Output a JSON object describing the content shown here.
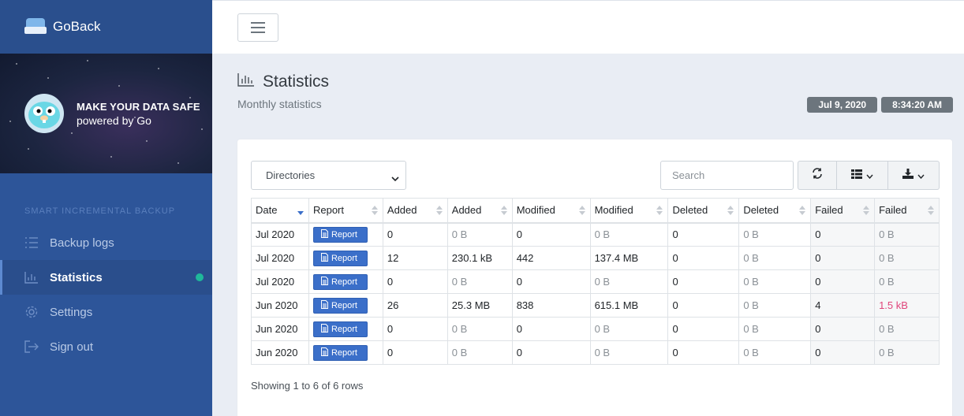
{
  "app": {
    "name": "GoBack"
  },
  "hero": {
    "title": "MAKE YOUR DATA SAFE",
    "subtitle": "powered by Go"
  },
  "sidebar": {
    "section_label": "SMART INCREMENTAL BACKUP",
    "items": [
      {
        "label": "Backup logs",
        "icon": "list-icon",
        "active": false
      },
      {
        "label": "Statistics",
        "icon": "bar-chart-icon",
        "active": true
      },
      {
        "label": "Settings",
        "icon": "gear-icon",
        "active": false
      },
      {
        "label": "Sign out",
        "icon": "sign-out-icon",
        "active": false
      }
    ]
  },
  "page": {
    "title": "Statistics",
    "subtitle": "Monthly statistics",
    "date": "Jul 9, 2020",
    "time": "8:34:20 AM"
  },
  "toolbar": {
    "select_value": "Directories",
    "search_placeholder": "Search"
  },
  "table": {
    "columns": [
      "Date",
      "Report",
      "Added",
      "Added",
      "Modified",
      "Modified",
      "Deleted",
      "Deleted",
      "Failed",
      "Failed"
    ],
    "report_label": "Report",
    "rows": [
      {
        "date": "Jul 2020",
        "added": "0",
        "added_size": "0 B",
        "modified": "0",
        "modified_size": "0 B",
        "deleted": "0",
        "deleted_size": "0 B",
        "failed": "0",
        "failed_size": "0 B"
      },
      {
        "date": "Jul 2020",
        "added": "12",
        "added_size": "230.1 kB",
        "modified": "442",
        "modified_size": "137.4 MB",
        "deleted": "0",
        "deleted_size": "0 B",
        "failed": "0",
        "failed_size": "0 B"
      },
      {
        "date": "Jul 2020",
        "added": "0",
        "added_size": "0 B",
        "modified": "0",
        "modified_size": "0 B",
        "deleted": "0",
        "deleted_size": "0 B",
        "failed": "0",
        "failed_size": "0 B"
      },
      {
        "date": "Jun 2020",
        "added": "26",
        "added_size": "25.3 MB",
        "modified": "838",
        "modified_size": "615.1 MB",
        "deleted": "0",
        "deleted_size": "0 B",
        "failed": "4",
        "failed_size": "1.5 kB"
      },
      {
        "date": "Jun 2020",
        "added": "0",
        "added_size": "0 B",
        "modified": "0",
        "modified_size": "0 B",
        "deleted": "0",
        "deleted_size": "0 B",
        "failed": "0",
        "failed_size": "0 B"
      },
      {
        "date": "Jun 2020",
        "added": "0",
        "added_size": "0 B",
        "modified": "0",
        "modified_size": "0 B",
        "deleted": "0",
        "deleted_size": "0 B",
        "failed": "0",
        "failed_size": "0 B"
      }
    ],
    "footer": "Showing 1 to 6 of 6 rows"
  },
  "colors": {
    "sidebar": "#2d5599",
    "accent": "#3b6fc9",
    "active_dot": "#1fb89a",
    "failed": "#e0457b"
  }
}
